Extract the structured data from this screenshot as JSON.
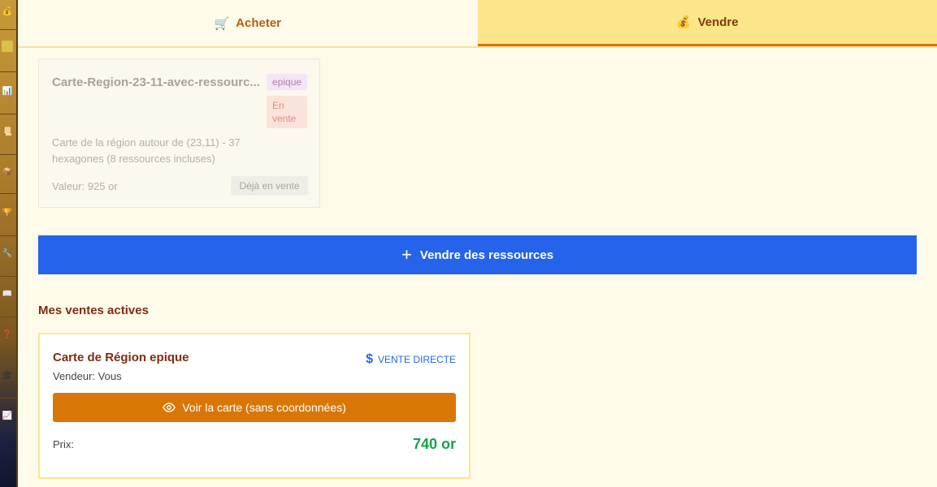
{
  "tabs": [
    {
      "label": "Acheter",
      "icon": "shopping-cart-icon",
      "emoji": "🛒"
    },
    {
      "label": "Vendre",
      "icon": "money-bag-icon",
      "emoji": "💰"
    }
  ],
  "inventory_item": {
    "title": "Carte-Region-23-11-avec-ressourc...",
    "rarity": "epique",
    "status": "En vente",
    "description": "Carte de la région autour de (23,11) - 37 hexagones (8 ressources incluses)",
    "value": "Valeur: 925 or",
    "button_label": "Déjà en vente"
  },
  "sell_button": {
    "label": "Vendre des ressources",
    "icon": "plus-icon"
  },
  "active_sales": {
    "title": "Mes ventes actives",
    "items": [
      {
        "title": "Carte de Région epique",
        "sale_type": "VENTE DIRECTE",
        "sale_type_icon": "dollar-icon",
        "seller": "Vendeur: Vous",
        "view_button": "Voir la carte (sans coordonnées)",
        "view_icon": "eye-icon",
        "price_label": "Prix:",
        "price": "740 or"
      }
    ]
  },
  "colors": {
    "background": "#fffbea",
    "accent_blue": "#2563eb",
    "accent_orange": "#d97706",
    "price_green": "#16a34a",
    "heading_brown": "#7c2d12"
  }
}
